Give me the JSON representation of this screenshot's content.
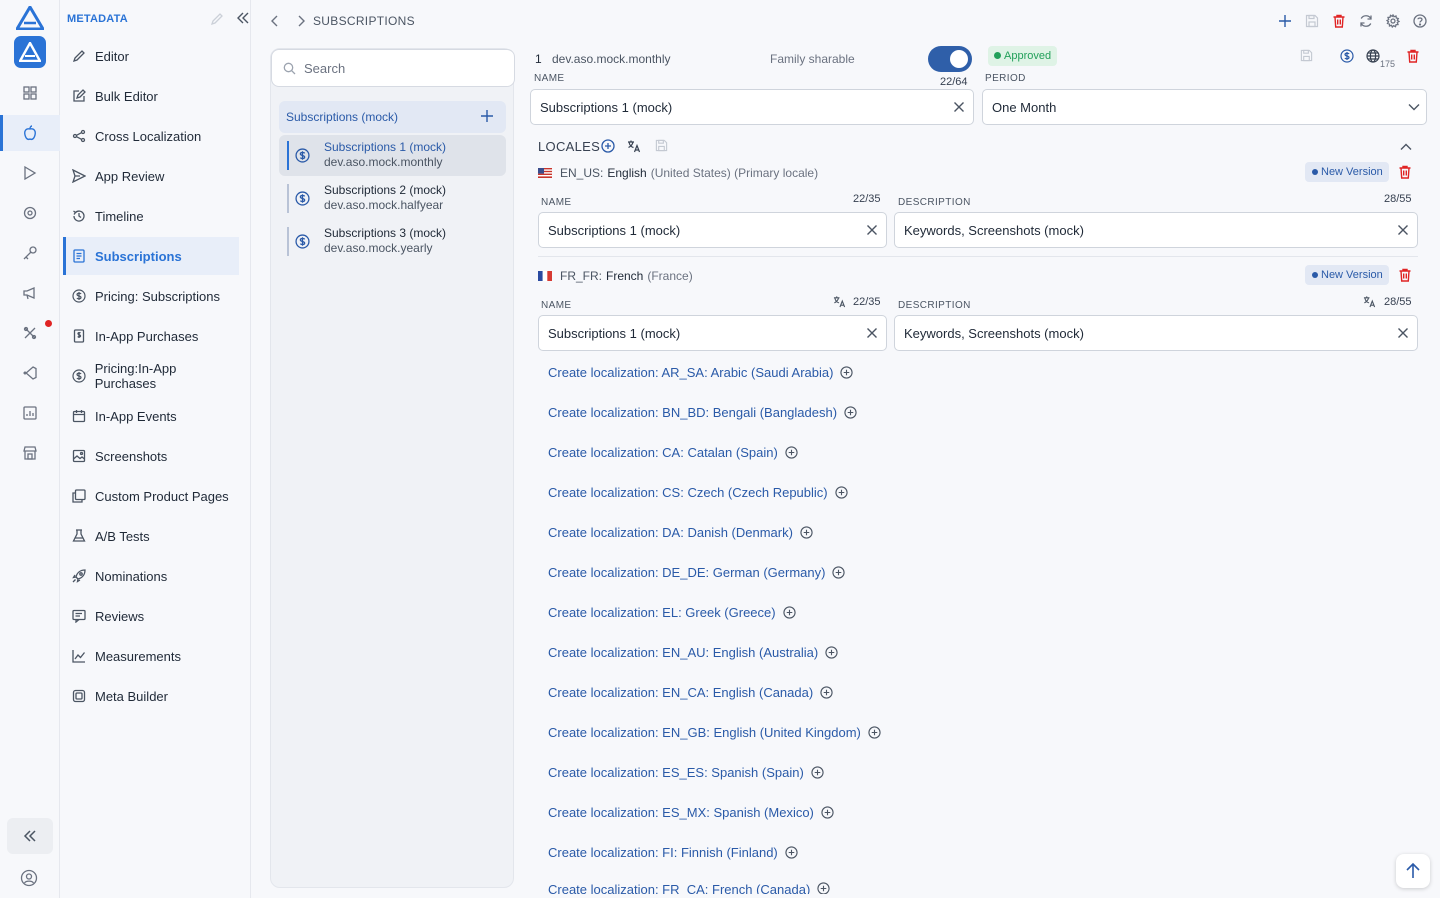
{
  "sidebar": {
    "title": "METADATA",
    "items": [
      {
        "label": "Editor",
        "icon": "pencil-icon"
      },
      {
        "label": "Bulk Editor",
        "icon": "edit-box-icon"
      },
      {
        "label": "Cross Localization",
        "icon": "share-icon"
      },
      {
        "label": "App Review",
        "icon": "send-icon"
      },
      {
        "label": "Timeline",
        "icon": "history-icon"
      },
      {
        "label": "Subscriptions",
        "icon": "document-icon"
      },
      {
        "label": "Pricing: Subscriptions",
        "icon": "dollar-circle-icon"
      },
      {
        "label": "In-App Purchases",
        "icon": "receipt-icon"
      },
      {
        "label": "Pricing:In-App Purchases",
        "icon": "dollar-circle-icon"
      },
      {
        "label": "In-App Events",
        "icon": "calendar-icon"
      },
      {
        "label": "Screenshots",
        "icon": "image-icon"
      },
      {
        "label": "Custom Product Pages",
        "icon": "pages-icon"
      },
      {
        "label": "A/B Tests",
        "icon": "flask-icon"
      },
      {
        "label": "Nominations",
        "icon": "rocket-icon"
      },
      {
        "label": "Reviews",
        "icon": "reviews-icon"
      },
      {
        "label": "Measurements",
        "icon": "chart-icon"
      },
      {
        "label": "Meta Builder",
        "icon": "layers-icon"
      }
    ]
  },
  "topbar": {
    "breadcrumb": "SUBSCRIPTIONS"
  },
  "list": {
    "search_placeholder": "Search",
    "group_title": "Subscriptions (mock)",
    "items": [
      {
        "name": "Subscriptions 1 (mock)",
        "id": "dev.aso.mock.monthly"
      },
      {
        "name": "Subscriptions 2 (mock)",
        "id": "dev.aso.mock.halfyear"
      },
      {
        "name": "Subscriptions 3 (mock)",
        "id": "dev.aso.mock.yearly"
      }
    ]
  },
  "detail": {
    "index": "1",
    "product_id": "dev.aso.mock.monthly",
    "family_sharable_label": "Family sharable",
    "family_sharable": true,
    "status": "Approved",
    "territories_count": "175",
    "name_label": "NAME",
    "name_value": "Subscriptions 1 (mock)",
    "name_count": "22/64",
    "period_label": "PERIOD",
    "period_value": "One Month",
    "locales_label": "LOCALES",
    "locales": [
      {
        "code": "EN_US:",
        "language": "English",
        "region": "(United States) (Primary locale)",
        "badge": "New Version",
        "name_label": "NAME",
        "name_value": "Subscriptions 1 (mock)",
        "name_count": "22/35",
        "desc_label": "DESCRIPTION",
        "desc_value": "Keywords, Screenshots (mock)",
        "desc_count": "28/55"
      },
      {
        "code": "FR_FR:",
        "language": "French",
        "region": "(France)",
        "badge": "New Version",
        "name_label": "NAME",
        "name_value": "Subscriptions 1 (mock)",
        "name_count": "22/35",
        "desc_label": "DESCRIPTION",
        "desc_value": "Keywords, Screenshots (mock)",
        "desc_count": "28/55"
      }
    ],
    "create_localizations": [
      "Create localization: AR_SA: Arabic (Saudi Arabia)",
      "Create localization: BN_BD: Bengali (Bangladesh)",
      "Create localization: CA: Catalan (Spain)",
      "Create localization: CS: Czech (Czech Republic)",
      "Create localization: DA: Danish (Denmark)",
      "Create localization: DE_DE: German (Germany)",
      "Create localization: EL: Greek (Greece)",
      "Create localization: EN_AU: English (Australia)",
      "Create localization: EN_CA: English (Canada)",
      "Create localization: EN_GB: English (United Kingdom)",
      "Create localization: ES_ES: Spanish (Spain)",
      "Create localization: ES_MX: Spanish (Mexico)",
      "Create localization: FI: Finnish (Finland)",
      "Create localization: FR_CA: French (Canada)"
    ]
  },
  "colors": {
    "accent": "#2a73d6",
    "link": "#2a5aa8",
    "danger": "#e02424",
    "success": "#22a05a"
  }
}
